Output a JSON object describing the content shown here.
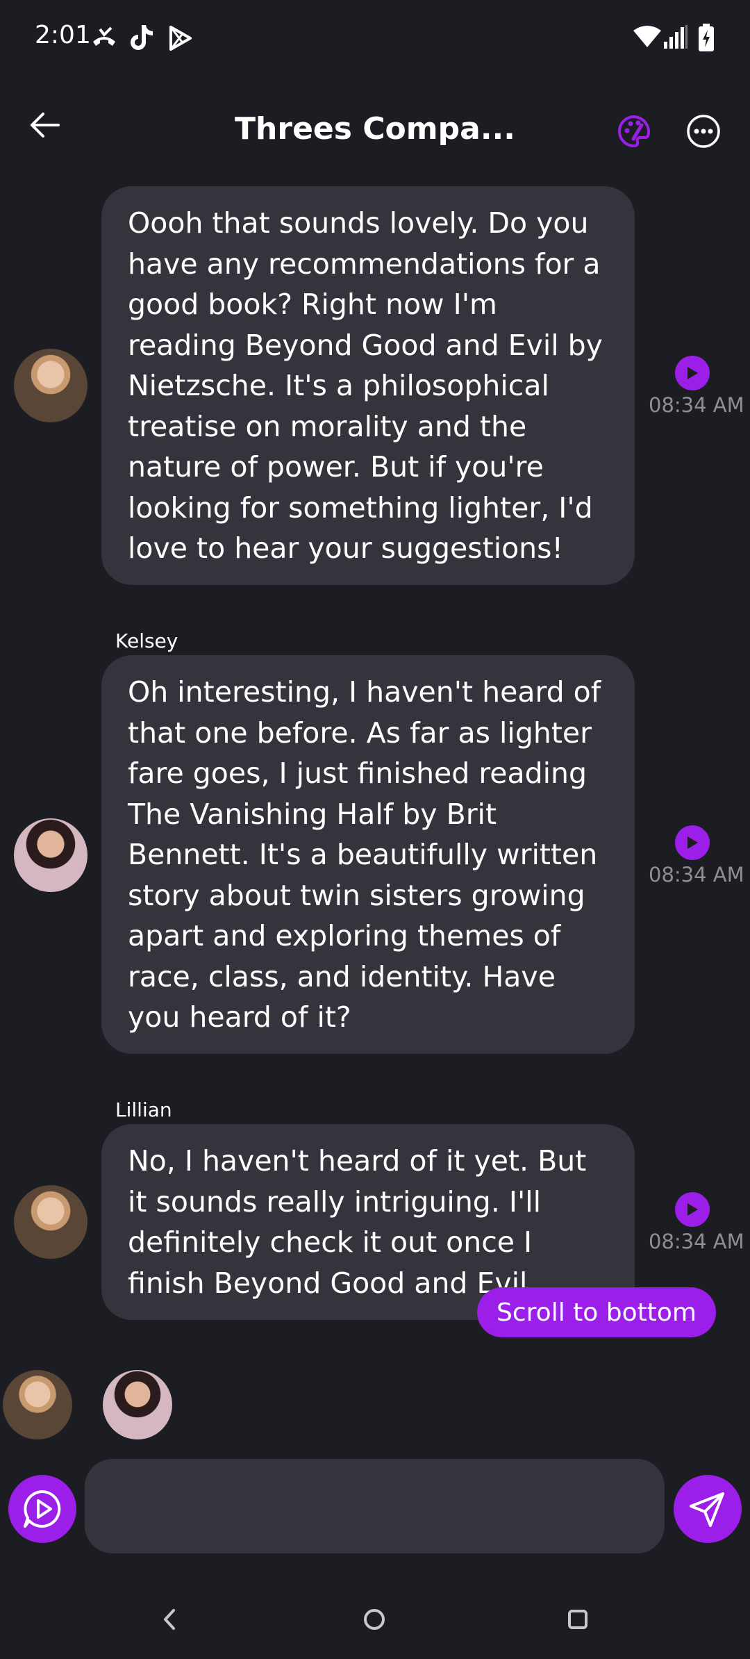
{
  "status_bar": {
    "time": "2:01",
    "icons": [
      "missed-call-icon",
      "tiktok-icon",
      "play-store-icon",
      "wifi-icon",
      "signal-icon",
      "battery-charging-icon"
    ]
  },
  "header": {
    "title": "Threes Compa...",
    "icons": [
      "back-arrow-icon",
      "palette-icon",
      "more-options-icon"
    ],
    "accent_color": "#9b1fe8"
  },
  "messages": [
    {
      "sender": "",
      "text": "Oooh that sounds lovely. Do you have any recommendations for a good book? Right now I'm reading Beyond Good and Evil by Nietzsche. It's a philosophical treatise on morality and the nature of power. But if you're looking for something lighter, I'd love to hear your suggestions!",
      "time": "08:34 AM"
    },
    {
      "sender": "Kelsey",
      "text": "Oh interesting, I haven't heard of that one before. As far as lighter fare goes, I just finished reading The Vanishing Half by Brit Bennett. It's a beautifully written story about twin sisters growing apart and exploring themes of race, class, and identity. Have you heard of it?",
      "time": "08:34 AM"
    },
    {
      "sender": "Lillian",
      "text": "No, I haven't heard of it yet. But it sounds really intriguing. I'll definitely check it out once I finish Beyond Good and Evil.",
      "time": "08:34 AM"
    }
  ],
  "scroll_button": {
    "label": "Scroll to bottom"
  },
  "composer": {
    "placeholder": "",
    "value": "",
    "icons": [
      "voice-chat-icon",
      "send-icon"
    ]
  },
  "nav_bar": {
    "icons": [
      "nav-back-icon",
      "nav-home-icon",
      "nav-recents-icon"
    ]
  }
}
